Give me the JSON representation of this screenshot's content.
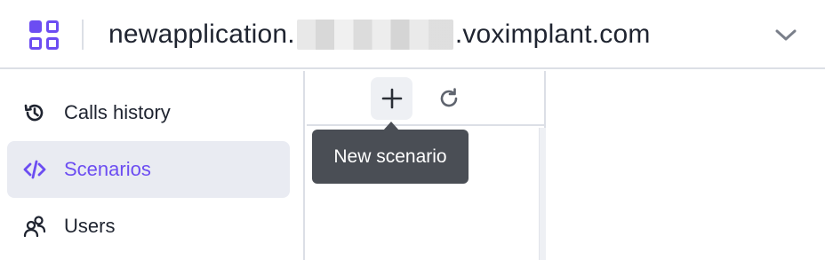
{
  "header": {
    "app_name_prefix": "newapplication.",
    "app_name_suffix": ".voximplant.com",
    "apps_icon": "apps-grid-icon",
    "dropdown_icon": "chevron-down-icon"
  },
  "sidebar": {
    "items": [
      {
        "label": "Calls history",
        "icon": "history-icon",
        "active": false
      },
      {
        "label": "Scenarios",
        "icon": "code-icon",
        "active": true
      },
      {
        "label": "Users",
        "icon": "users-icon",
        "active": false
      }
    ]
  },
  "toolbar": {
    "add_icon": "plus-icon",
    "refresh_icon": "refresh-icon",
    "tooltip": "New scenario"
  },
  "colors": {
    "accent": "#6c4df2",
    "active_bg": "#e9ebf2",
    "tooltip_bg": "#4a4e55",
    "border": "#dcdfe6"
  }
}
